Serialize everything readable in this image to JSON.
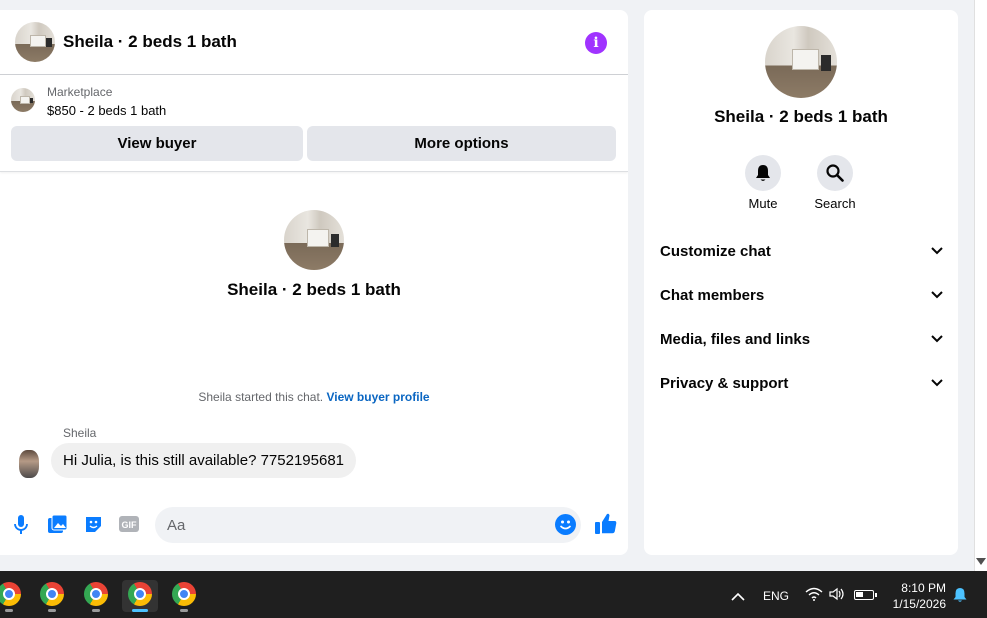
{
  "chat": {
    "title": "Sheila · 2 beds 1 bath",
    "listing": {
      "source": "Marketplace",
      "price_title": "$850 - 2 beds 1 bath",
      "view_buyer_label": "View buyer",
      "more_options_label": "More options"
    },
    "intro_title": "Sheila · 2 beds 1 bath",
    "system_message": "Sheila started this chat.",
    "system_link": "View buyer profile",
    "sender_name": "Sheila",
    "message": "Hi Julia, is this still available? 7752195681",
    "composer_placeholder": "Aa",
    "composer_icons": [
      "mic-icon",
      "photo-icon",
      "sticker-icon",
      "gif-icon",
      "emoji-icon",
      "like-icon"
    ],
    "gif_label": "GIF"
  },
  "side": {
    "title": "Sheila · 2 beds 1 bath",
    "actions": [
      {
        "label": "Mute",
        "icon": "bell-icon"
      },
      {
        "label": "Search",
        "icon": "search-icon"
      }
    ],
    "sections": [
      {
        "label": "Customize chat"
      },
      {
        "label": "Chat members"
      },
      {
        "label": "Media, files and links"
      },
      {
        "label": "Privacy & support"
      }
    ]
  },
  "taskbar": {
    "apps": [
      "chrome-icon",
      "chrome-icon",
      "chrome-icon",
      "chrome-icon",
      "chrome-icon"
    ],
    "active_app_index": 3,
    "language": "ENG",
    "time": "8:10 PM",
    "date": "1/15/2026"
  },
  "colors": {
    "accent": "#0a7cff",
    "info": "#a033ff",
    "link": "#0a66c2",
    "button_bg": "#e4e6eb",
    "bubble_bg": "#f0f0f0"
  }
}
